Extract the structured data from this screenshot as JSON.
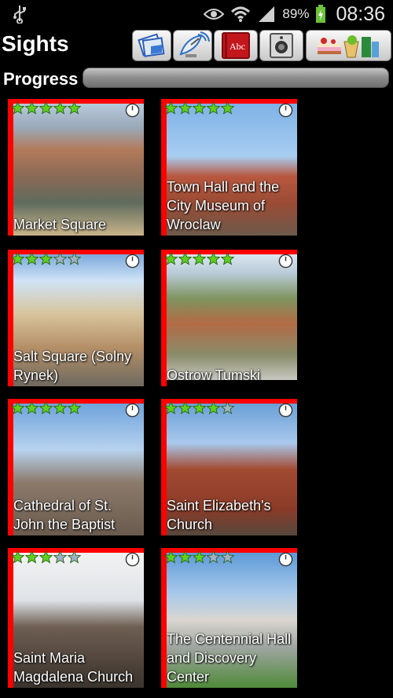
{
  "statusbar": {
    "battery_pct": "89%",
    "clock": "08:36",
    "icons": [
      "usb-icon",
      "eye-icon",
      "wifi-icon",
      "signal-icon",
      "battery-icon"
    ]
  },
  "header": {
    "title": "Sights",
    "buttons": [
      "bookmarks-button",
      "dish-button",
      "dictionary-button",
      "speaker-button",
      "food-drink-button"
    ]
  },
  "progress": {
    "label": "Progress",
    "value": 0
  },
  "colors": {
    "card_frame": "#ff0000",
    "star_on": "#5fcf1f",
    "star_off": "#9fb0c4"
  },
  "sights": [
    {
      "name": "Market Square",
      "stars": 5
    },
    {
      "name": "Town Hall and the City Museum of Wroclaw",
      "stars": 5
    },
    {
      "name": "Salt Square (Solny Rynek)",
      "stars": 3
    },
    {
      "name": "Ostrow Tumski",
      "stars": 5
    },
    {
      "name": "Cathedral of St. John the Baptist",
      "stars": 5
    },
    {
      "name": "Saint Elizabeth's Church",
      "stars": 4
    },
    {
      "name": "Saint Maria Magdalena Church",
      "stars": 3
    },
    {
      "name": "The Centennial Hall and Discovery Center",
      "stars": 3
    }
  ]
}
